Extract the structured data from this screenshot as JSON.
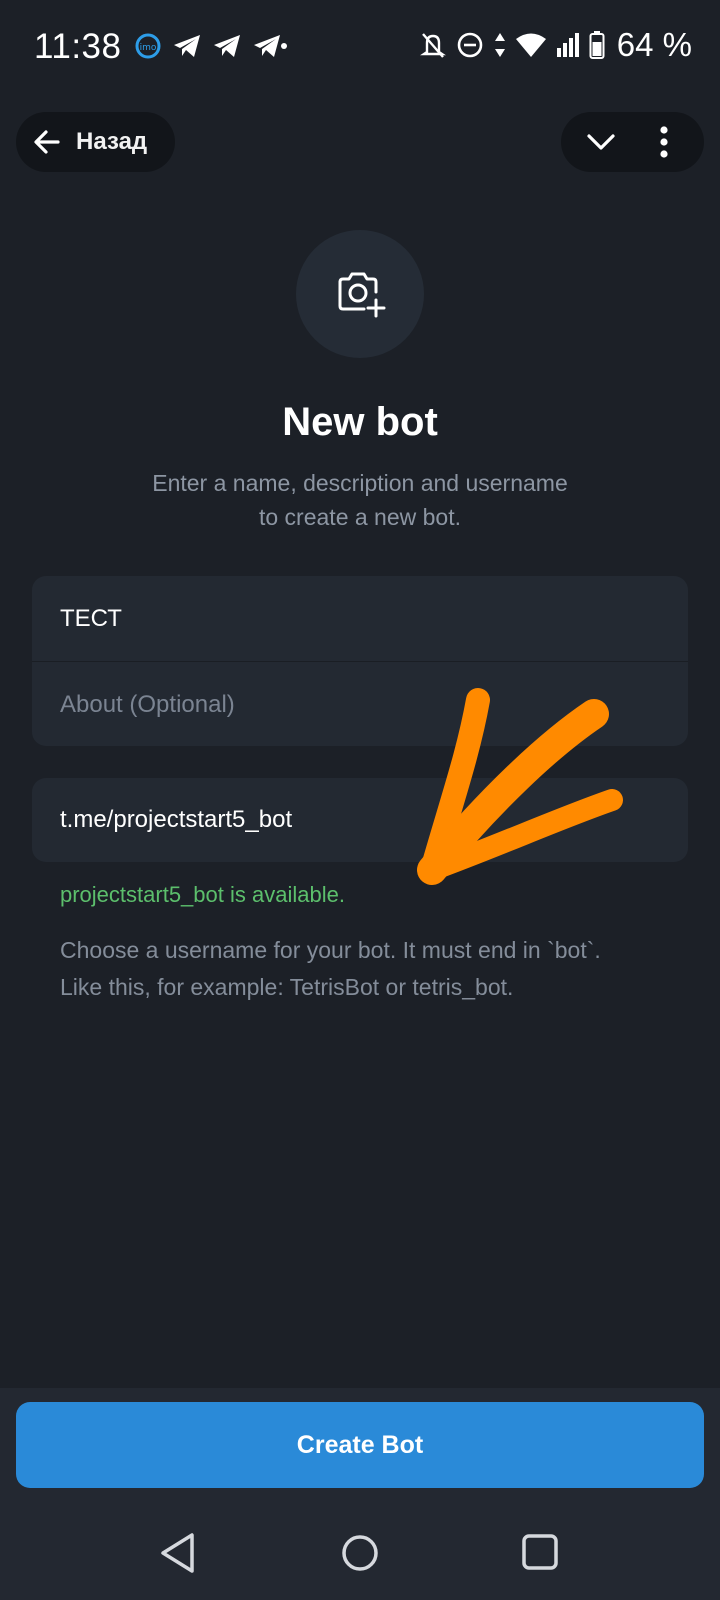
{
  "status_bar": {
    "time": "11:38",
    "battery": "64 %",
    "icons": [
      "imo-icon",
      "telegram-icon",
      "telegram-icon",
      "telegram-icon",
      "mute-icon",
      "dnd-icon",
      "data-arrows-icon",
      "wifi-icon",
      "signal-icon",
      "battery-icon"
    ]
  },
  "header": {
    "back_label": "Назад"
  },
  "page": {
    "title": "New bot",
    "subtitle_line1": "Enter a name, description and username",
    "subtitle_line2": "to create a new bot."
  },
  "form": {
    "name_value": "ТЕСТ",
    "about_placeholder": "About (Optional)",
    "username_value": "t.me/projectstart5_bot",
    "availability": "projectstart5_bot is available.",
    "hint_line1": "Choose a username for your bot. It must end in `bot`.",
    "hint_line2": "Like this, for example: TetrisBot or tetris_bot."
  },
  "footer": {
    "create_label": "Create Bot"
  },
  "colors": {
    "background": "#1c2027",
    "card": "#232932",
    "accent": "#2a8ad8",
    "success": "#5cbf6c",
    "annotation": "#ff8a00"
  }
}
